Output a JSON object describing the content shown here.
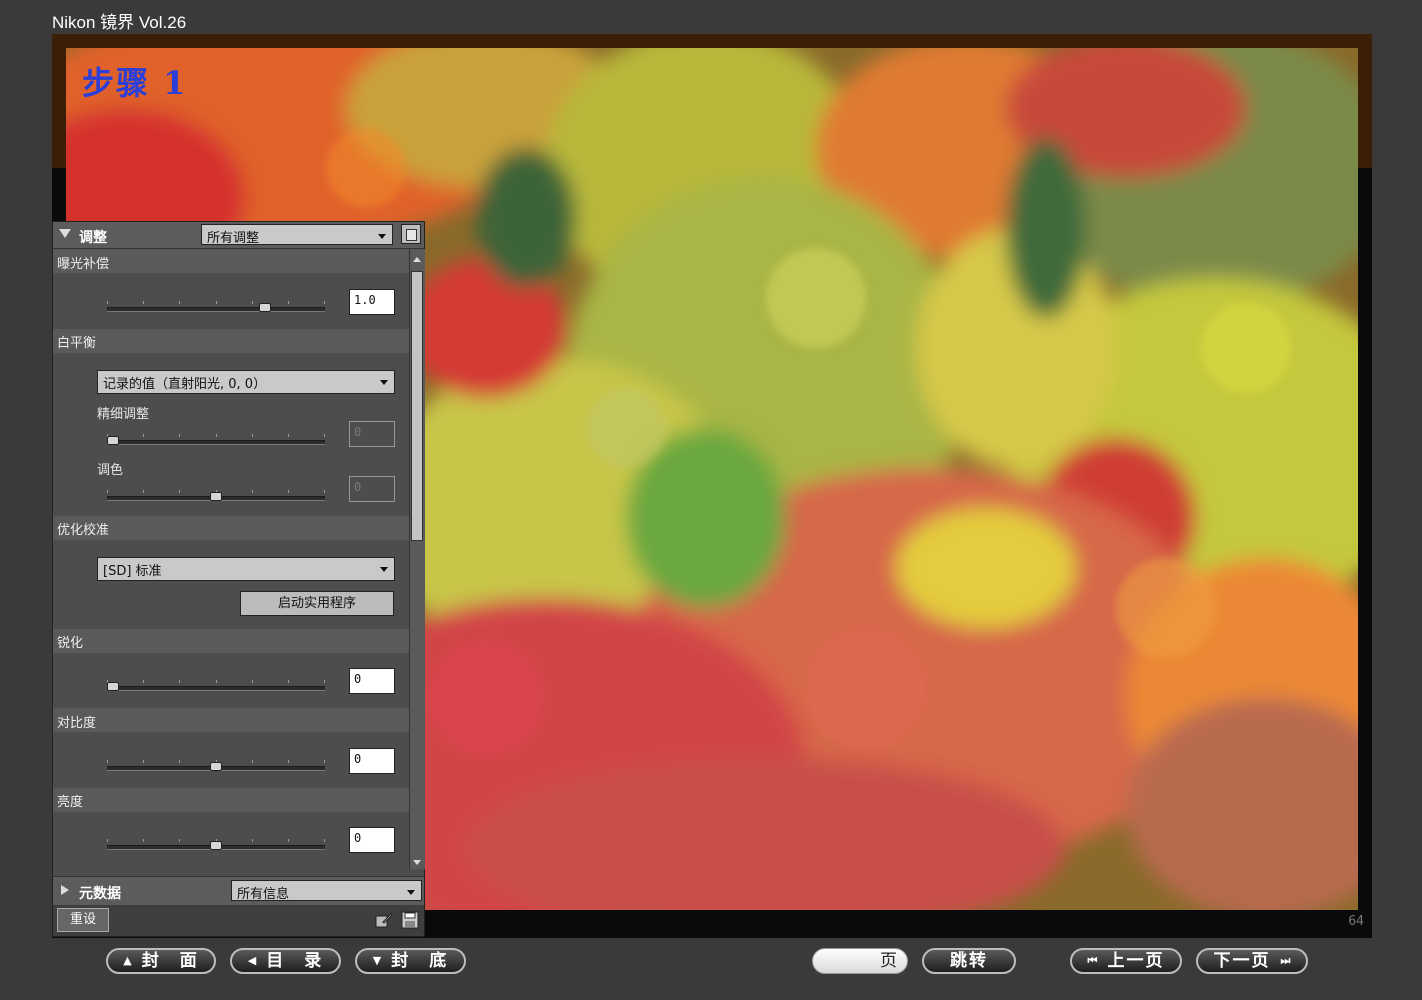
{
  "app": {
    "title": "Nikon 镜界 Vol.26"
  },
  "photo": {
    "step_label": "步骤 1",
    "page_number": "64"
  },
  "panel": {
    "header": {
      "title": "调整",
      "filter_value": "所有调整"
    },
    "exposure": {
      "label": "曝光补偿",
      "value": "1.0",
      "slider_fraction": 0.74
    },
    "white_balance": {
      "label": "白平衡",
      "preset_value": "记录的值（直射阳光, 0, 0）",
      "fine_label": "精细调整",
      "fine_value": "0",
      "fine_slider_fraction": 0.0,
      "tint_label": "调色",
      "tint_value": "0",
      "tint_slider_fraction": 0.5
    },
    "picture_control": {
      "label": "优化校准",
      "preset_value": "[SD] 标准",
      "launch_label": "启动实用程序"
    },
    "sharpening": {
      "label": "锐化",
      "value": "0",
      "slider_fraction": 0.0
    },
    "contrast": {
      "label": "对比度",
      "value": "0",
      "slider_fraction": 0.5
    },
    "brightness": {
      "label": "亮度",
      "value": "0",
      "slider_fraction": 0.5
    },
    "metadata": {
      "title": "元数据",
      "filter_value": "所有信息"
    },
    "footer": {
      "reset_label": "重设"
    }
  },
  "nav": {
    "cover_label": "封　面",
    "contents_label": "目　录",
    "back_cover_label": "封　底",
    "page_field_value": "页",
    "jump_label": "跳转",
    "prev_label": "上一页",
    "next_label": "下一页"
  },
  "icons": {
    "cover": "triangle-up-icon",
    "contents": "triangle-left-icon",
    "back_cover": "triangle-down-icon",
    "prev": "skip-back-icon",
    "next": "skip-forward-icon"
  },
  "colors": {
    "step_label": "#2b3fd8",
    "background": "#3a3a3a"
  }
}
